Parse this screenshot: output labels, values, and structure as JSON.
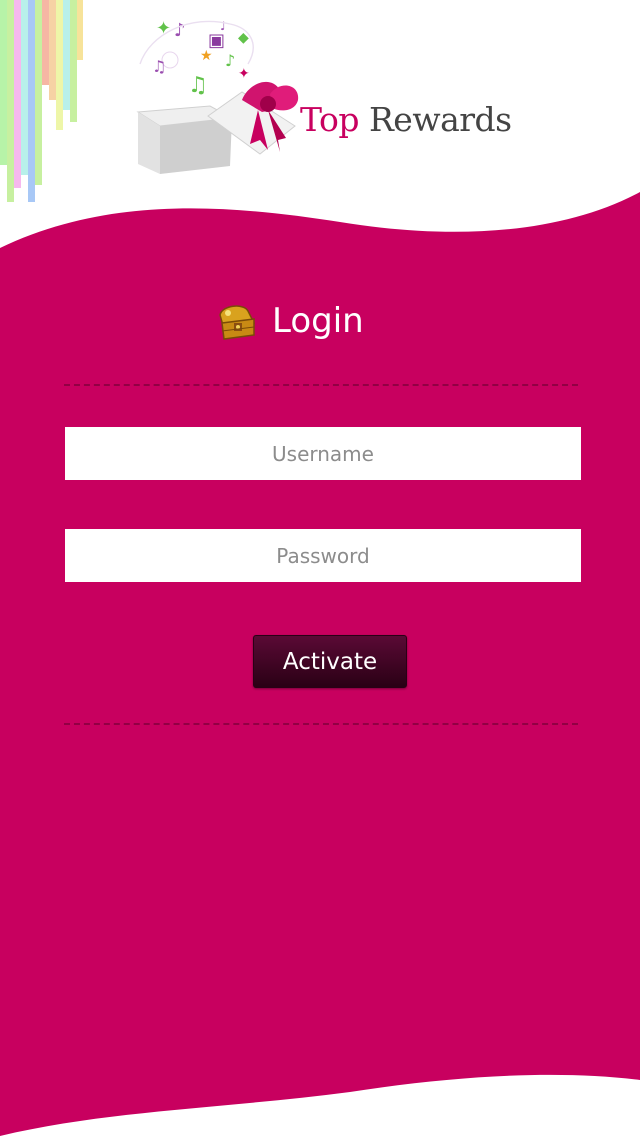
{
  "brand": {
    "name_part1": "Top",
    "name_part2": "Rewards"
  },
  "colors": {
    "primary": "#c8005f",
    "button_dark": "#3a0622",
    "stripes": [
      "#b7f3a8",
      "#f6b8ee",
      "#b8f0ea",
      "#a8c8f6",
      "#f6b6a4",
      "#f6d2a4",
      "#eef6a8",
      "#f7e39a",
      "#c7f0a0"
    ]
  },
  "icons": {
    "logo": "gift-box-logo-icon",
    "login": "treasure-chest-icon"
  },
  "login": {
    "title": "Login",
    "username_placeholder": "Username",
    "password_placeholder": "Password",
    "submit_label": "Activate"
  }
}
